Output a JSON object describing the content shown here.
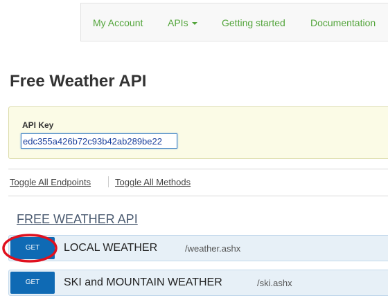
{
  "nav": {
    "items": [
      {
        "label": "My Account"
      },
      {
        "label": "APIs"
      },
      {
        "label": "Getting started"
      },
      {
        "label": "Documentation"
      }
    ]
  },
  "page": {
    "title": "Free Weather API"
  },
  "api_key": {
    "label": "API Key",
    "value": "edc355a426b72c93b42ab289be22"
  },
  "toggles": {
    "endpoints": "Toggle All Endpoints",
    "methods": "Toggle All Methods"
  },
  "section": {
    "title": "FREE WEATHER API"
  },
  "endpoints": [
    {
      "method": "GET",
      "name": "LOCAL WEATHER",
      "path": "/weather.ashx"
    },
    {
      "method": "GET",
      "name": "SKI and MOUNTAIN WEATHER",
      "path": "/ski.ashx"
    }
  ],
  "colors": {
    "nav_link": "#52a43a",
    "method_get": "#0f6ab4",
    "highlight": "#e0101e"
  },
  "icons": {
    "apis_dropdown": "caret-down-icon"
  }
}
